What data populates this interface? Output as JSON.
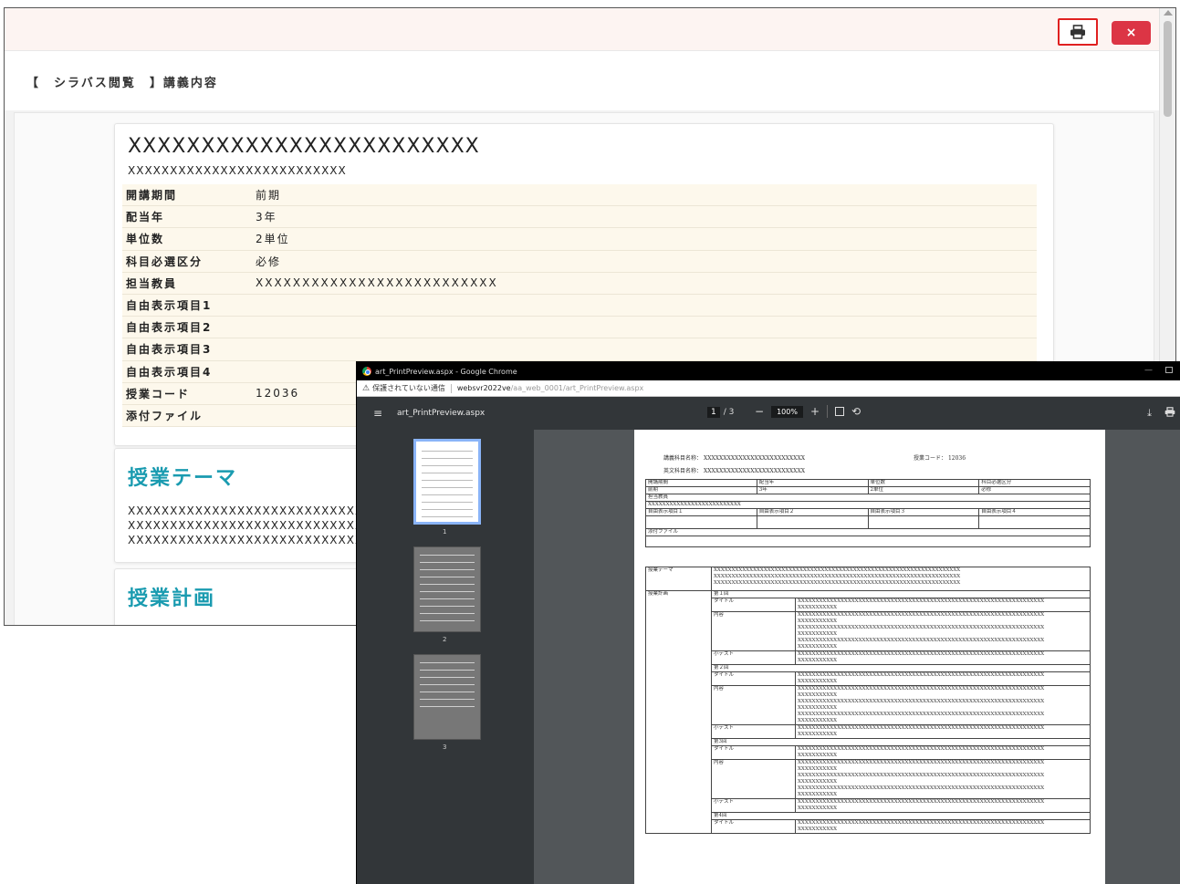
{
  "syllabus": {
    "breadcrumb": "【　シラバス閲覧　】講義内容",
    "close_label": "×",
    "print_icon": "printer-icon",
    "course_title": "XXXXXXXXXXXXXXXXXXXXXXXX",
    "course_title_en": "XXXXXXXXXXXXXXXXXXXXXXXXXX",
    "info": [
      {
        "label": "開講期間",
        "value": "前期"
      },
      {
        "label": "配当年",
        "value": "3年"
      },
      {
        "label": "単位数",
        "value": "2単位"
      },
      {
        "label": "科目必選区分",
        "value": "必修"
      },
      {
        "label": "担当教員",
        "value": "XXXXXXXXXXXXXXXXXXXXXXXXXX"
      },
      {
        "label": "自由表示項目1",
        "value": ""
      },
      {
        "label": "自由表示項目2",
        "value": ""
      },
      {
        "label": "自由表示項目3",
        "value": ""
      },
      {
        "label": "自由表示項目4",
        "value": ""
      },
      {
        "label": "授業コード",
        "value": "12036"
      },
      {
        "label": "添付ファイル",
        "value": ""
      }
    ],
    "theme_heading": "授業テーマ",
    "theme_lines": [
      "XXXXXXXXXXXXXXXXXXXXXXXXXXXXX",
      "XXXXXXXXXXXXXXXXXXXXXXXXXXXXX",
      "XXXXXXXXXXXXXXXXXXXXXXXXXXXXX"
    ],
    "plan_heading": "授業計画",
    "accent_color": "#1a9bb0",
    "close_color": "#dc3545"
  },
  "preview": {
    "window_title": "art_PrintPreview.aspx - Google Chrome",
    "security_label": "保護されていない通信",
    "url_host": "websvr2022ve",
    "url_path": "/aa_web_0001/art_PrintPreview.aspx",
    "file_name": "art_PrintPreview.aspx",
    "page_current": "1",
    "page_total": "/ 3",
    "zoom": "100%",
    "thumbnails": [
      "1",
      "2",
      "3"
    ],
    "paper": {
      "course_label": "講義科目名称：",
      "course_value": "XXXXXXXXXXXXXXXXXXXXXXXXXX",
      "english_label": "英文科目名称：",
      "english_value": "XXXXXXXXXXXXXXXXXXXXXXXXXX",
      "code_label": "授業コード：",
      "code_value": "12036",
      "header_labels": [
        "開講期間",
        "配当年",
        "単位数",
        "科目必選区分"
      ],
      "header_values": [
        "前期",
        "3年",
        "2単位",
        "必修"
      ],
      "teacher_label": "担当教員",
      "teacher_value": "XXXXXXXXXXXXXXXXXXXXXXXXXX",
      "free_items": [
        "自由表示項目１",
        "自由表示項目２",
        "自由表示項目３",
        "自由表示項目４"
      ],
      "attach_label": "添付ファイル",
      "theme_label": "授業テーマ",
      "plan_label": "授業計画",
      "long_x": "XXXXXXXXXXXXXXXXXXXXXXXXXXXXXXXXXXXXXXXXXXXXXXXXXXXXXXXXXXXXXXXXXXXXX",
      "short_x": "XXXXXXXXXXX",
      "session1": "第１回",
      "session2": "第２回",
      "session3": "第3回",
      "session4": "第4回",
      "title_label": "タイトル",
      "content_label": "内容",
      "test_label": "小テスト"
    }
  }
}
